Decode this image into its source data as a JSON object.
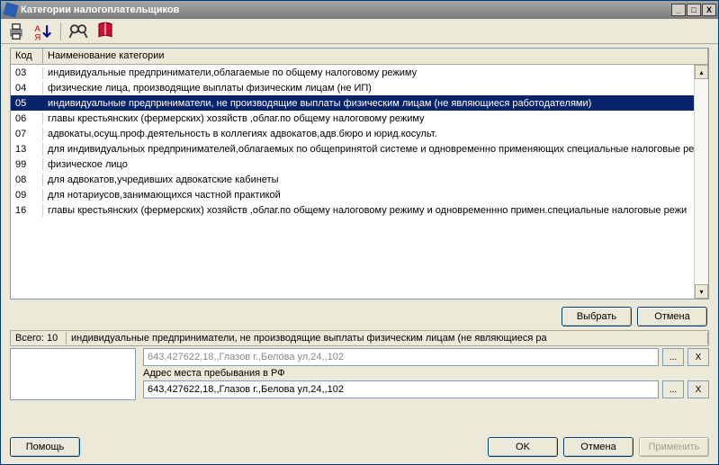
{
  "window": {
    "title": "Категории налогоплательщиков",
    "controls": {
      "min": "_",
      "max": "□",
      "close": "X"
    }
  },
  "toolbar": {
    "icons": [
      "print-icon",
      "sort-icon",
      "find-icon",
      "help-icon"
    ]
  },
  "table": {
    "headers": {
      "code": "Код",
      "name": "Наименование категории"
    },
    "selected_index": 2,
    "rows": [
      {
        "code": "03",
        "name": "индивидуальные предприниматели,облагаемые по общему налоговому режиму"
      },
      {
        "code": "04",
        "name": "физические лица, производящие выплаты физическим лицам (не ИП)"
      },
      {
        "code": "05",
        "name": "индивидуальные предприниматели, не производящие выплаты физическим лицам (не являющиеся работодателями)"
      },
      {
        "code": "06",
        "name": "главы крестьянских (фермерских) хозяйств ,облаг.по общему налоговому режиму"
      },
      {
        "code": "07",
        "name": "адвокаты,осущ.проф.деятельность в коллегиях адвокатов,адв.бюро и юрид.косульт."
      },
      {
        "code": "13",
        "name": "для индивидуальных предпринимателей,облагаемых по общепринятой системе и одновременно применяющих специальные налоговые рех"
      },
      {
        "code": "99",
        "name": "физическое лицо"
      },
      {
        "code": "08",
        "name": "для адвокатов,учредивших адвокатские кабинеты"
      },
      {
        "code": "09",
        "name": "для нотариусов,занимающихся частной практикой"
      },
      {
        "code": "16",
        "name": "главы крестьянских (фермерских) хозяйств ,облаг.по общему налоговому режиму и одновременнно примен.специальные налоговые режи"
      }
    ]
  },
  "dialog_buttons": {
    "select": "Выбрать",
    "cancel": "Отмена"
  },
  "status": {
    "total_label": "Всего:",
    "total_value": "10",
    "current": "индивидуальные предприниматели, не производящие выплаты физическим лицам (не являющиеся ра"
  },
  "address": {
    "top_value": "643,427622,18,,Глазов г.,Белова ул,24,,102",
    "label": "Адрес места пребывания в РФ",
    "value": "643,427622,18,,Глазов г.,Белова ул,24,,102",
    "btn_more": "...",
    "btn_clear": "X"
  },
  "footer": {
    "help": "Помощь",
    "ok": "OK",
    "cancel": "Отмена",
    "apply": "Применить"
  }
}
